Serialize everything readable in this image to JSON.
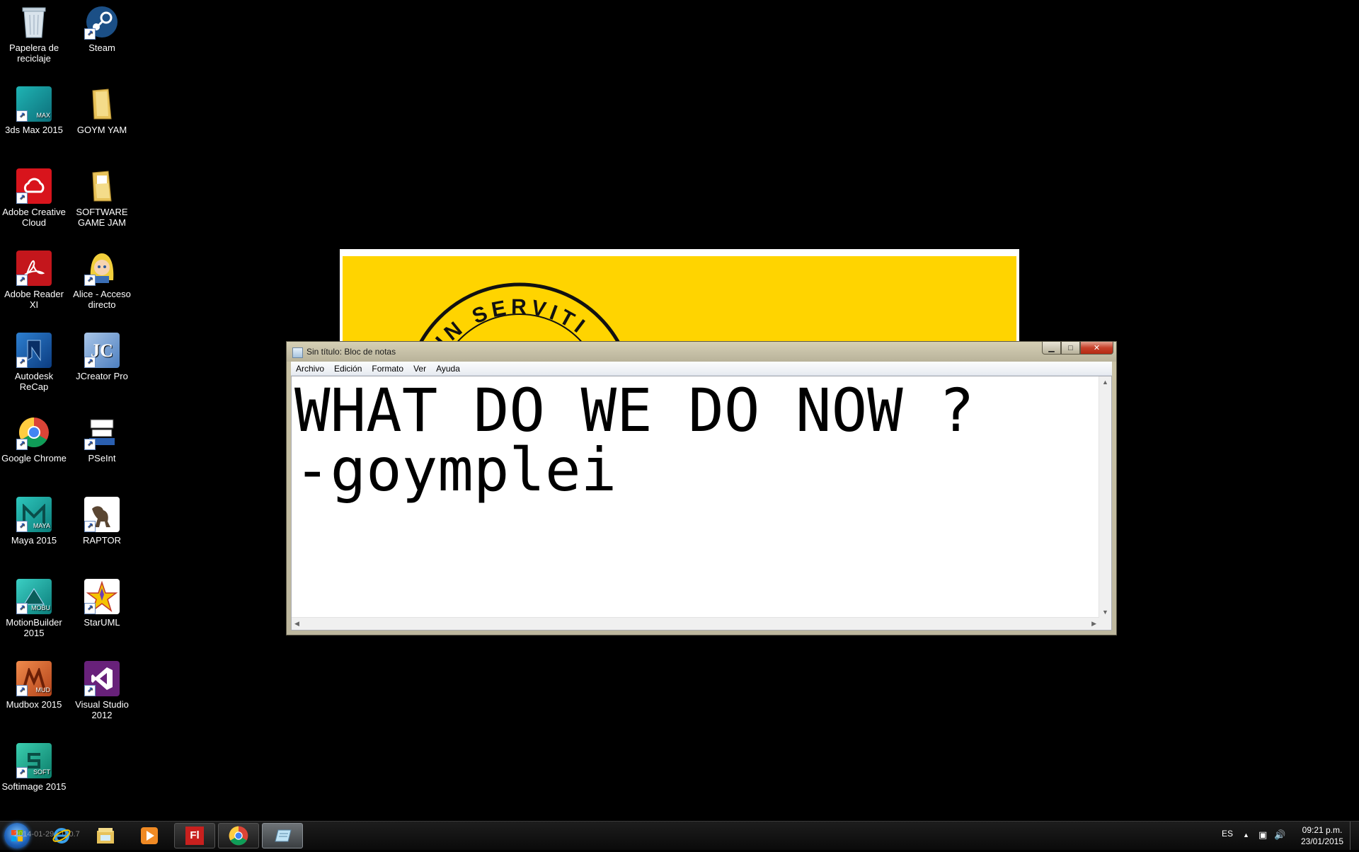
{
  "desktop": {
    "icons": [
      {
        "label": "Papelera de reciclaje",
        "icon": "recycle-bin-icon"
      },
      {
        "label": "Steam",
        "icon": "steam-icon"
      },
      {
        "label": "3ds Max 2015",
        "icon": "3dsmax-icon"
      },
      {
        "label": "GOYM YAM",
        "icon": "folder-icon"
      },
      {
        "label": "Adobe Creative Cloud",
        "icon": "creative-cloud-icon"
      },
      {
        "label": "SOFTWARE GAME JAM",
        "icon": "folder-icon"
      },
      {
        "label": "Adobe Reader XI",
        "icon": "adobe-reader-icon"
      },
      {
        "label": "Alice - Acceso directo",
        "icon": "alice-icon"
      },
      {
        "label": "Autodesk ReCap",
        "icon": "recap-icon"
      },
      {
        "label": "JCreator Pro",
        "icon": "jcreator-icon"
      },
      {
        "label": "Google Chrome",
        "icon": "chrome-icon"
      },
      {
        "label": "PSeInt",
        "icon": "pseint-icon"
      },
      {
        "label": "Maya 2015",
        "icon": "maya-icon"
      },
      {
        "label": "RAPTOR",
        "icon": "raptor-icon"
      },
      {
        "label": "MotionBuilder 2015",
        "icon": "motionbuilder-icon"
      },
      {
        "label": "StarUML",
        "icon": "staruml-icon"
      },
      {
        "label": "Mudbox 2015",
        "icon": "mudbox-icon"
      },
      {
        "label": "Visual Studio 2012",
        "icon": "visual-studio-icon"
      },
      {
        "label": "Softimage 2015",
        "icon": "softimage-icon"
      }
    ],
    "shortcut_glyph": "↗"
  },
  "background_window": {
    "seal_text": "IS IN SERVITI"
  },
  "notepad": {
    "title": "Sin título: Bloc de notas",
    "window_buttons": {
      "minimize": "▁",
      "maximize": "□",
      "close": "✕"
    },
    "menu": [
      "Archivo",
      "Edición",
      "Formato",
      "Ver",
      "Ayuda"
    ],
    "content_line1": "WHAT DO WE DO NOW ?",
    "content_line2": "-goymplei",
    "scroll_up": "▲",
    "scroll_down": "▼",
    "scroll_left": "◀",
    "scroll_right": "▶"
  },
  "taskbar": {
    "quick_launch": [
      "internet-explorer-icon",
      "file-explorer-icon",
      "media-player-icon"
    ],
    "tasks": [
      {
        "label": "Fl",
        "icon": "flash-icon",
        "active": false
      },
      {
        "label": "",
        "icon": "chrome-icon",
        "active": false
      },
      {
        "label": "",
        "icon": "notepad-icon",
        "active": true
      }
    ],
    "overlay_text": "2014-01-29 | 160.7",
    "tray": {
      "language": "ES",
      "show_hidden": "▲",
      "network": "▣",
      "volume": "🔊"
    },
    "clock": {
      "time": "09:21 p.m.",
      "date": "23/01/2015"
    }
  },
  "colors": {
    "desktop_bg": "#000000",
    "banner_yellow": "#ffd400",
    "close_red": "#c6402a"
  }
}
